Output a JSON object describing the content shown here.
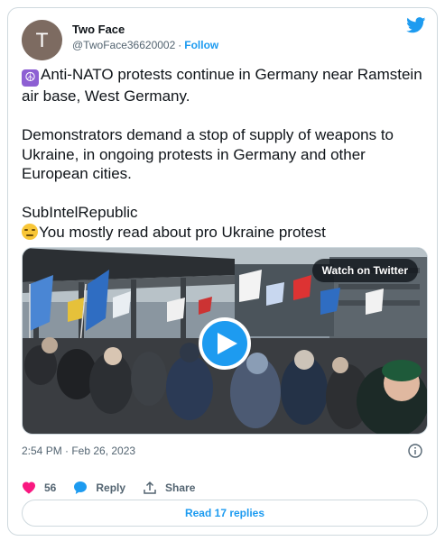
{
  "author": {
    "avatar_initial": "T",
    "name": "Two Face",
    "handle": "@TwoFace36620002",
    "separator": "·",
    "follow_label": "Follow"
  },
  "tweet": {
    "lines": [
      {
        "emoji": "peace-symbol-icon",
        "text": "Anti-NATO protests continue in Germany near Ramstein air base, West  Germany."
      },
      {
        "text": "Demonstrators demand a stop of supply of weapons to Ukraine, in ongoing protests in Germany and other European cities."
      },
      {
        "text": "SubIntelRepublic"
      },
      {
        "emoji": "unamused-face-icon",
        "text": "You mostly read about pro Ukraine protest"
      }
    ]
  },
  "media": {
    "badge_label": "Watch on Twitter",
    "play_icon": "play-icon"
  },
  "meta": {
    "timestamp": "2:54 PM · Feb 26, 2023"
  },
  "actions": {
    "like_count": "56",
    "reply_label": "Reply",
    "share_label": "Share"
  },
  "footer": {
    "read_replies_label": "Read 17 replies"
  },
  "colors": {
    "accent": "#1d9bf0",
    "like": "#f91880",
    "text_primary": "#0f1419",
    "text_secondary": "#536471",
    "border": "#cfd9de"
  }
}
